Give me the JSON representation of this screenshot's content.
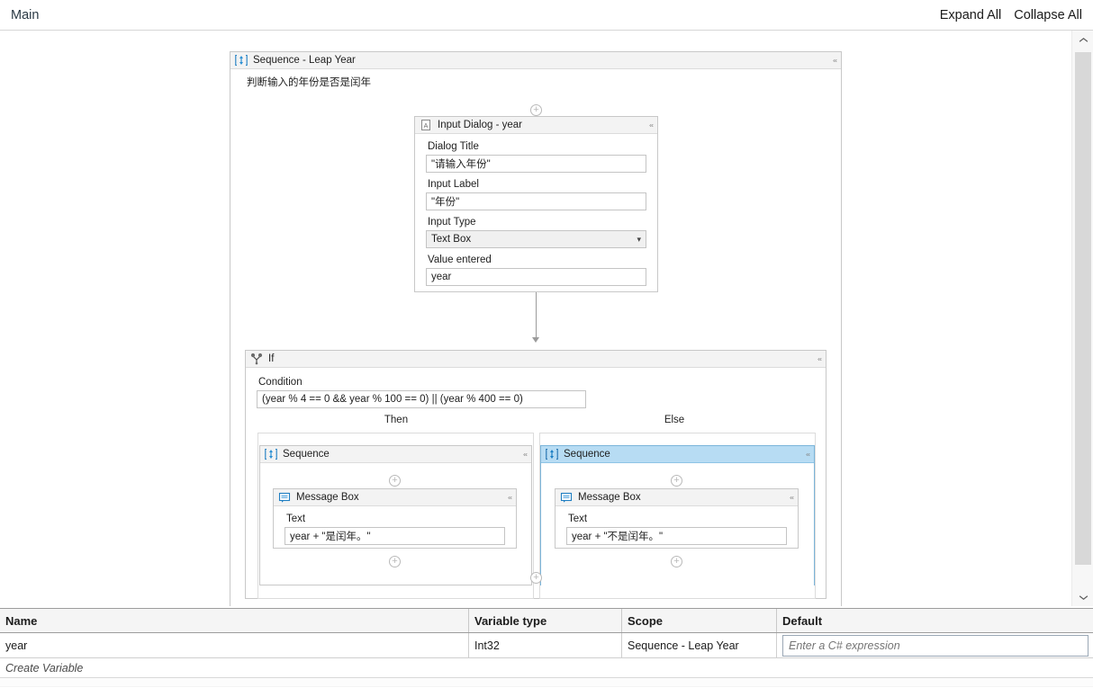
{
  "topbar": {
    "title": "Main",
    "expand_all": "Expand All",
    "collapse_all": "Collapse All"
  },
  "workflow": {
    "root_sequence": {
      "icon": "sequence-icon",
      "title": "Sequence - Leap Year",
      "annotation": "判断输入的年份是否是闰年",
      "collapse_glyph": "«"
    },
    "input_dialog": {
      "icon": "document-a-icon",
      "title": "Input Dialog - year",
      "fields": [
        {
          "label": "Dialog Title",
          "value": "\"请输入年份\"",
          "type": "text"
        },
        {
          "label": "Input Label",
          "value": "\"年份\"",
          "type": "text"
        },
        {
          "label": "Input Type",
          "value": "Text Box",
          "type": "select"
        },
        {
          "label": "Value entered",
          "value": "year",
          "type": "text"
        }
      ]
    },
    "if_activity": {
      "icon": "fork-icon",
      "title": "If",
      "condition_label": "Condition",
      "condition_value": "(year % 4 == 0 && year % 100 == 0) || (year % 400 == 0)",
      "then_label": "Then",
      "else_label": "Else"
    },
    "then_branch": {
      "sequence_title": "Sequence",
      "selected": false,
      "message_box": {
        "icon": "message-box-icon",
        "title": "Message Box",
        "text_label": "Text",
        "text_value": "year + \"是闰年。\""
      }
    },
    "else_branch": {
      "sequence_title": "Sequence",
      "selected": true,
      "message_box": {
        "icon": "message-box-icon",
        "title": "Message Box",
        "text_label": "Text",
        "text_value": "year + \"不是闰年。\""
      }
    },
    "add_glyph": "+"
  },
  "variables": {
    "columns": [
      "Name",
      "Variable type",
      "Scope",
      "Default"
    ],
    "rows": [
      {
        "name": "year",
        "type": "Int32",
        "scope": "Sequence - Leap Year",
        "default_placeholder": "Enter a C# expression",
        "default_value": ""
      }
    ],
    "create_variable": "Create Variable"
  },
  "scrollbar": {
    "up_glyph": "⌃",
    "down_glyph": "⌄"
  },
  "colors": {
    "selection_blue": "#b7dcf3",
    "icon_blue": "#1f7ec2",
    "border_grey": "#c8c8c8"
  }
}
